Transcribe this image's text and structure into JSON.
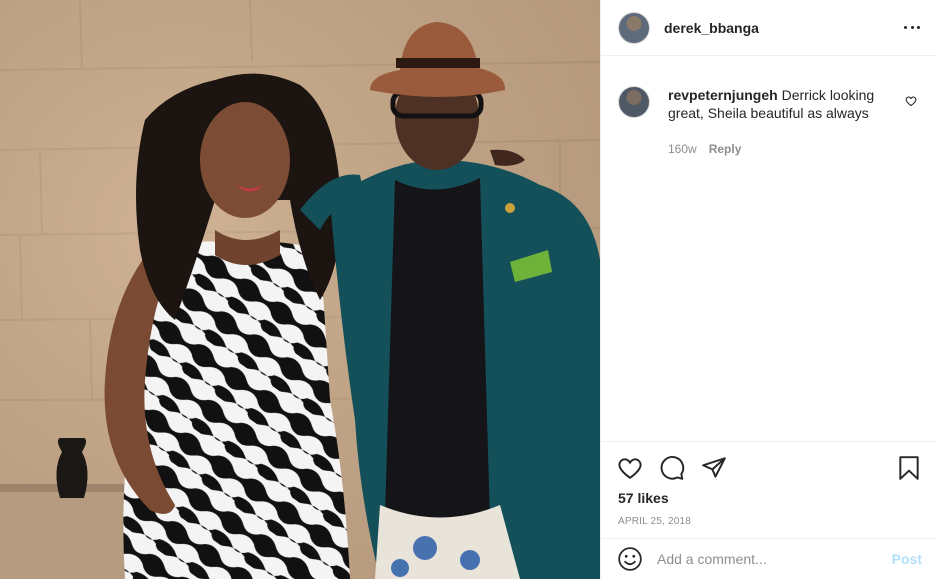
{
  "post": {
    "author": "derek_bbanga",
    "image_alt": ""
  },
  "comments": [
    {
      "user": "revpeternjungeh",
      "text": "Derrick looking great, Sheila beautiful as always",
      "age": "160w",
      "reply_label": "Reply"
    }
  ],
  "engagement": {
    "likes": "57 likes",
    "date": "APRIL 25, 2018"
  },
  "composer": {
    "placeholder": "Add a comment...",
    "post_label": "Post"
  },
  "icons": {
    "like": "heart-icon",
    "comment": "comment-icon",
    "share": "share-icon",
    "save": "bookmark-icon",
    "emoji": "emoji-icon",
    "more": "more-options-icon"
  },
  "colors": {
    "text": "#262626",
    "muted": "#8e8e8e",
    "border": "#efefef",
    "post_button_disabled": "#b2dffc"
  }
}
